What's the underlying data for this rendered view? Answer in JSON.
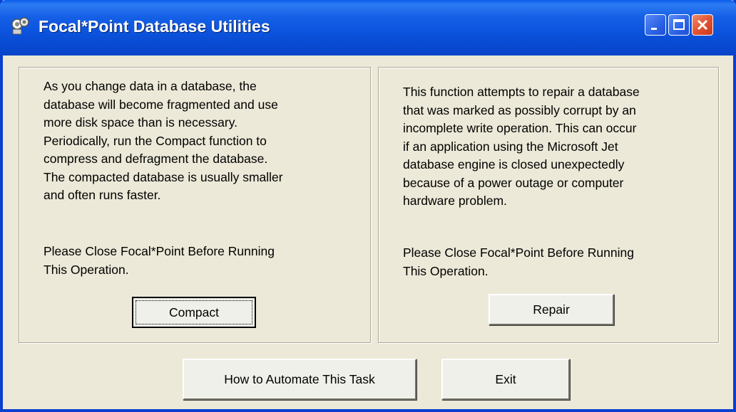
{
  "window": {
    "title": "Focal*Point Database Utilities",
    "app_icon": "database-utilities-icon",
    "controls": {
      "minimize": "minimize-icon",
      "maximize": "maximize-icon",
      "close": "close-icon"
    }
  },
  "compact_panel": {
    "description": "As you change data in a database, the\ndatabase will become fragmented and use\nmore disk space than is necessary.\nPeriodically, run the Compact function to\ncompress and defragment the database.\nThe compacted database is usually smaller\nand often runs faster.",
    "note": "Please Close Focal*Point Before Running\nThis Operation.",
    "button_label": "Compact"
  },
  "repair_panel": {
    "description": "This function attempts to repair a database\nthat was marked as possibly corrupt by an\nincomplete write operation. This can occur\nif an application using the Microsoft Jet\ndatabase engine is closed unexpectedly\nbecause of a power outage or computer\nhardware problem.",
    "note": "Please Close Focal*Point Before Running\nThis Operation.",
    "button_label": "Repair"
  },
  "footer": {
    "automate_label": "How to Automate This Task",
    "exit_label": "Exit"
  },
  "colors": {
    "titlebar": "#0A52DC",
    "dialog_background": "#ECE9D8",
    "close_button": "#E0502F"
  }
}
